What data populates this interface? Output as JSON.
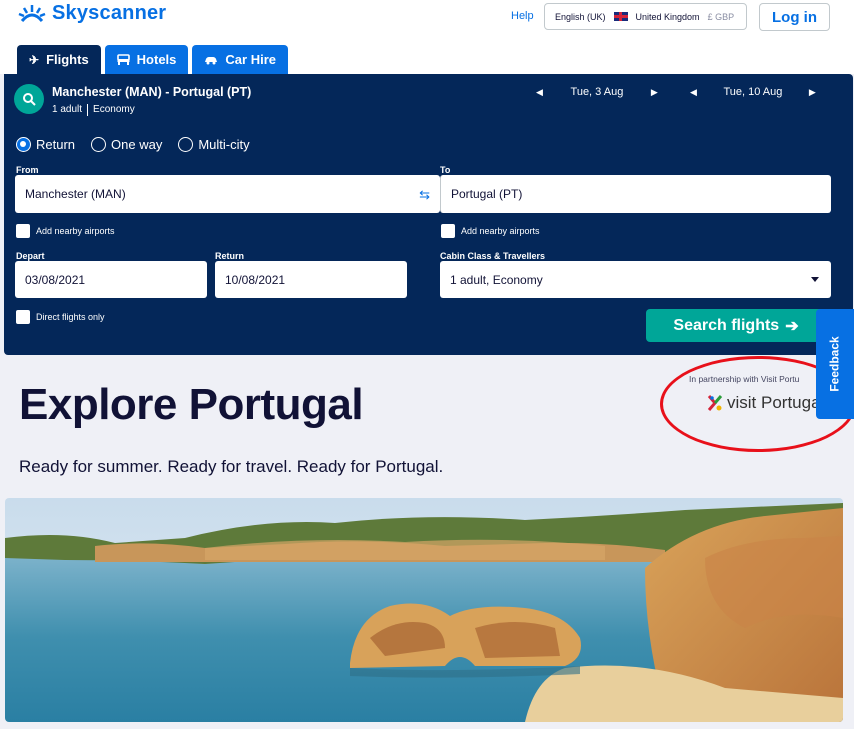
{
  "header": {
    "brand": "Skyscanner",
    "help": "Help",
    "locale": {
      "language": "English (UK)",
      "country": "United Kingdom",
      "currency": "£ GBP"
    },
    "login": "Log in"
  },
  "tabs": [
    {
      "label": "Flights",
      "icon": "plane-icon",
      "active": true
    },
    {
      "label": "Hotels",
      "icon": "bed-icon",
      "active": false
    },
    {
      "label": "Car Hire",
      "icon": "car-icon",
      "active": false
    }
  ],
  "summary": {
    "route": "Manchester (MAN) - Portugal (PT)",
    "passengers": "1 adult",
    "cabin": "Economy",
    "depart_date": "Tue, 3 Aug",
    "return_date": "Tue, 10 Aug"
  },
  "trip_types": [
    "Return",
    "One way",
    "Multi-city"
  ],
  "form": {
    "from_label": "From",
    "from_value": "Manchester (MAN)",
    "to_label": "To",
    "to_value": "Portugal (PT)",
    "nearby_airports": "Add nearby airports",
    "depart_label": "Depart",
    "depart_value": "03/08/2021",
    "return_label": "Return",
    "return_value": "10/08/2021",
    "cabin_label": "Cabin Class & Travellers",
    "cabin_value": "1 adult, Economy",
    "direct_only": "Direct flights only",
    "search_button": "Search flights"
  },
  "feedback": "Feedback",
  "explore": {
    "title": "Explore Portugal",
    "subtitle": "Ready for summer. Ready for travel. Ready for Portugal.",
    "partner_note": "In partnership with Visit Portu",
    "partner_logo": "visit Portugal"
  },
  "colors": {
    "brand_blue": "#0770e3",
    "panel_navy": "#042759",
    "search_green": "#00a698",
    "annotation_red": "#e8101a"
  }
}
